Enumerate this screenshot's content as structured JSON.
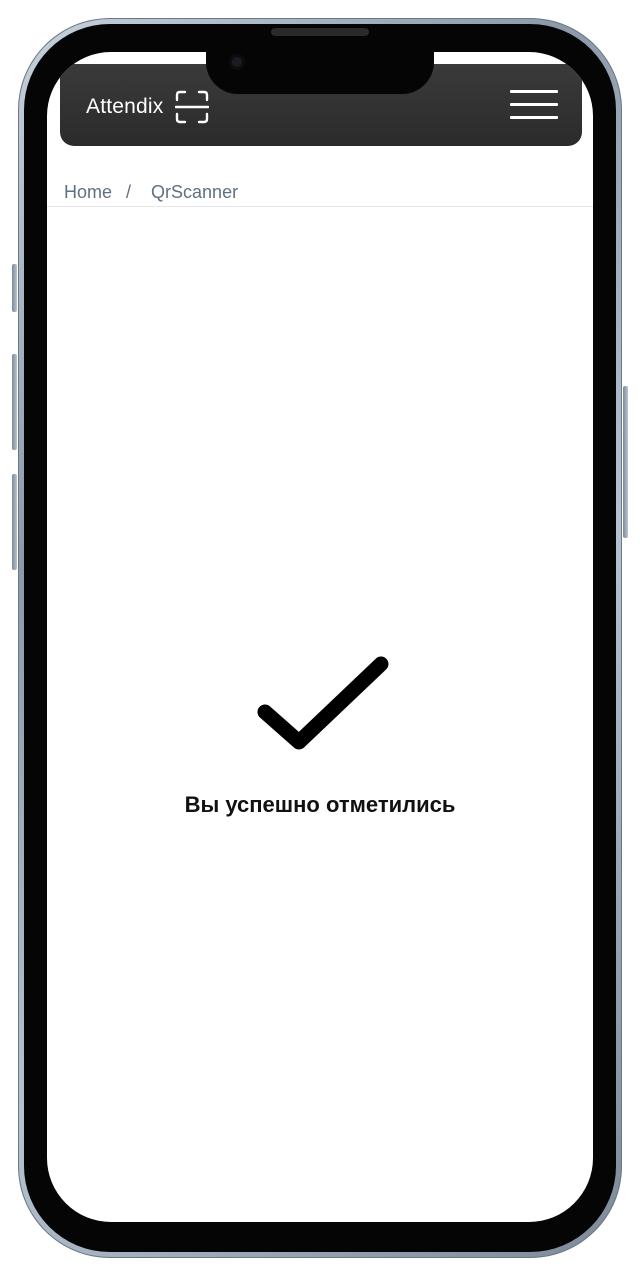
{
  "navbar": {
    "brand": "Attendix",
    "brand_icon": "qr-scan-icon",
    "menu_icon": "hamburger-menu-icon"
  },
  "breadcrumb": {
    "items": [
      "Home",
      "QrScanner"
    ],
    "separator": "/"
  },
  "success": {
    "icon": "checkmark-icon",
    "message": "Вы успешно отметились"
  },
  "colors": {
    "navbar_bg": "#2f2f2f",
    "breadcrumb_text": "#5f7080",
    "message_text": "#111111",
    "check_stroke": "#000000"
  }
}
